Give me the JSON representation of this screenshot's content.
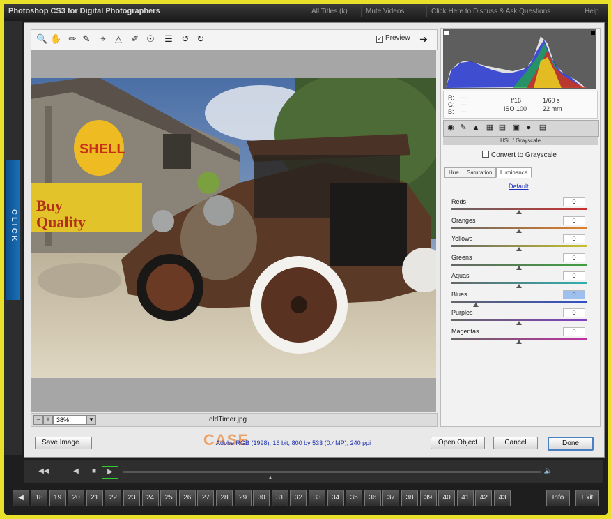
{
  "window": {
    "title": "Photoshop CS3 for Digital Photographers",
    "links": [
      "All Titles (k)",
      "Mute Videos",
      "Click Here to Discuss & Ask Questions",
      "Help"
    ],
    "side_label": "CLICK"
  },
  "toolbar": {
    "tools": [
      "zoom-icon",
      "hand-icon",
      "white-balance-icon",
      "color-sampler-icon",
      "crop-icon",
      "straighten-icon",
      "retouch-icon",
      "red-eye-icon",
      "preferences-icon",
      "rotate-left-icon",
      "rotate-right-icon"
    ],
    "preview_label": "Preview",
    "preview_checked": true
  },
  "status": {
    "zoom": "38%",
    "filename": "oldTimer.jpg"
  },
  "info": {
    "r": "R:",
    "g": "G:",
    "b": "B:",
    "dashes": "---",
    "aperture": "f/16",
    "shutter": "1/60 s",
    "iso": "ISO 100",
    "focal": "22 mm"
  },
  "panel": {
    "section_title": "HSL / Grayscale",
    "convert_label": "Convert to Grayscale",
    "subtabs": [
      "Hue",
      "Saturation",
      "Luminance"
    ],
    "active_subtab": "Luminance",
    "default_label": "Default",
    "sliders": [
      {
        "label": "Reds",
        "value": "0",
        "pos": 0.5,
        "color": "#c83030"
      },
      {
        "label": "Oranges",
        "value": "0",
        "pos": 0.5,
        "color": "#e0802a"
      },
      {
        "label": "Yellows",
        "value": "0",
        "pos": 0.5,
        "color": "#c8c030"
      },
      {
        "label": "Greens",
        "value": "0",
        "pos": 0.5,
        "color": "#40a040"
      },
      {
        "label": "Aquas",
        "value": "0",
        "pos": 0.5,
        "color": "#30b0b0"
      },
      {
        "label": "Blues",
        "value": "0",
        "pos": 0.18,
        "color": "#3050c8"
      },
      {
        "label": "Purples",
        "value": "0",
        "pos": 0.5,
        "color": "#8040c0"
      },
      {
        "label": "Magentas",
        "value": "0",
        "pos": 0.5,
        "color": "#c030a0"
      }
    ]
  },
  "footer": {
    "save_label": "Save Image...",
    "link_text": "Adobe RGB (1998); 16 bit; 800 by 533 (0.4MP); 240 ppi",
    "logo_text": "CASE",
    "open_label": "Open Object",
    "cancel_label": "Cancel",
    "done_label": "Done"
  },
  "player": {
    "chapters": [
      "18",
      "19",
      "20",
      "21",
      "22",
      "23",
      "24",
      "25",
      "26",
      "27",
      "28",
      "29",
      "30",
      "31",
      "32",
      "33",
      "34",
      "35",
      "36",
      "37",
      "38",
      "39",
      "40",
      "41",
      "42",
      "43"
    ],
    "info_label": "Info",
    "exit_label": "Exit"
  },
  "colors": {
    "accent": "#4a7fc4",
    "frame": "#e8e02a",
    "link": "#1a2fb0"
  }
}
